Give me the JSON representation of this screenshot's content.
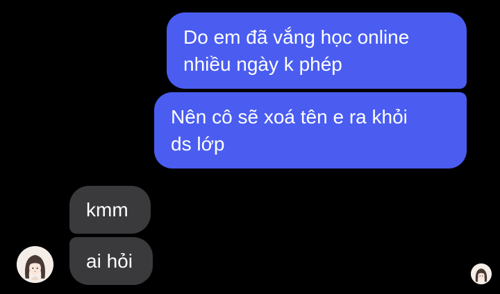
{
  "conversation": {
    "messages": [
      {
        "sender": "me",
        "text": "Do em đã vắng học online\nnhiều ngày k phép"
      },
      {
        "sender": "me",
        "text": "Nên cô sẽ xoá tên e ra khỏi\nds lớp"
      },
      {
        "sender": "other",
        "text": "kmm"
      },
      {
        "sender": "other",
        "text": "ai hỏi"
      }
    ]
  },
  "colors": {
    "background": "#000000",
    "outgoing_bubble": "#4a5df0",
    "incoming_bubble": "#3a3a3c",
    "text": "#ffffff"
  },
  "icons": {
    "contact_avatar": "girl-avatar-icon",
    "read_receipt": "read-receipt-avatar-icon"
  }
}
